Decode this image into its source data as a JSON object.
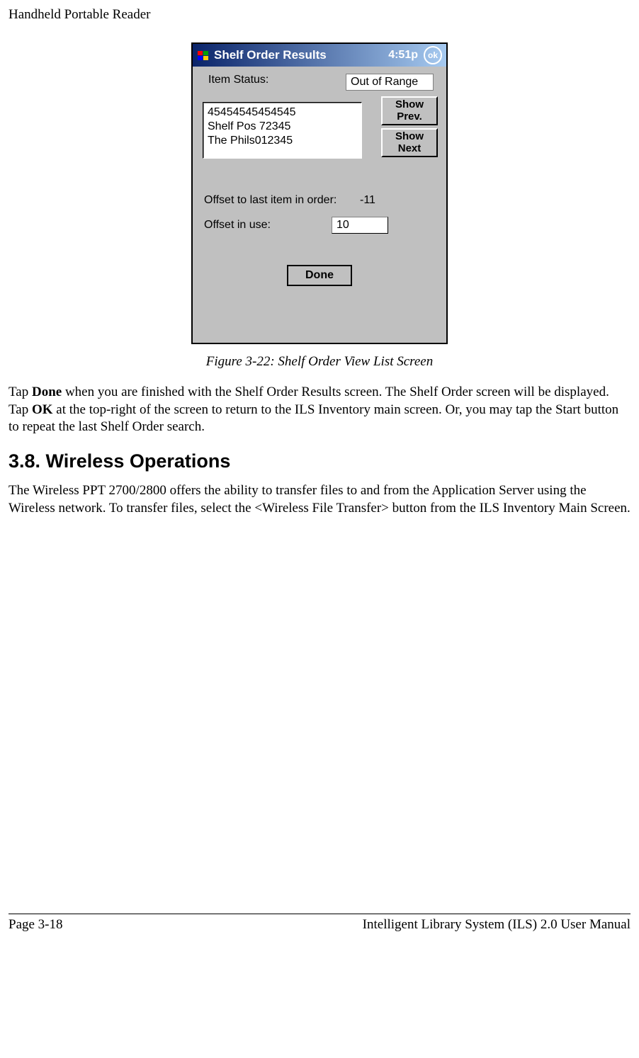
{
  "header": "Handheld Portable Reader",
  "screenshot": {
    "title": "Shelf Order Results",
    "time": "4:51p",
    "ok": "ok",
    "item_status_label": "Item Status:",
    "item_status_value": "Out of Range",
    "item_line1": "45454545454545",
    "item_line2": "Shelf Pos 72345",
    "item_line3": "The Phils012345",
    "show_prev": "Show Prev.",
    "show_next": "Show Next",
    "offset_last_label": "Offset to last item in order:",
    "offset_last_value": "-11",
    "offset_in_use_label": "Offset in use:",
    "offset_in_use_value": "10",
    "done": "Done"
  },
  "caption": "Figure 3-22: Shelf Order View List Screen",
  "para1_a": "Tap ",
  "para1_b": "Done",
  "para1_c": " when you are finished with the Shelf Order Results screen. The Shelf Order screen will be displayed. Tap ",
  "para1_d": "OK",
  "para1_e": " at the top-right of the screen to return to the ILS Inventory main screen. Or, you may tap the Start button to repeat the last Shelf Order search.",
  "section_heading": "3.8.  Wireless Operations",
  "para2": "The Wireless PPT 2700/2800 offers the ability to transfer files to and from the Application Server using the Wireless network. To transfer files, select the <Wireless File Transfer> button from the ILS Inventory Main Screen.",
  "footer_left": "Page 3-18",
  "footer_right": "Intelligent Library System (ILS) 2.0 User Manual"
}
